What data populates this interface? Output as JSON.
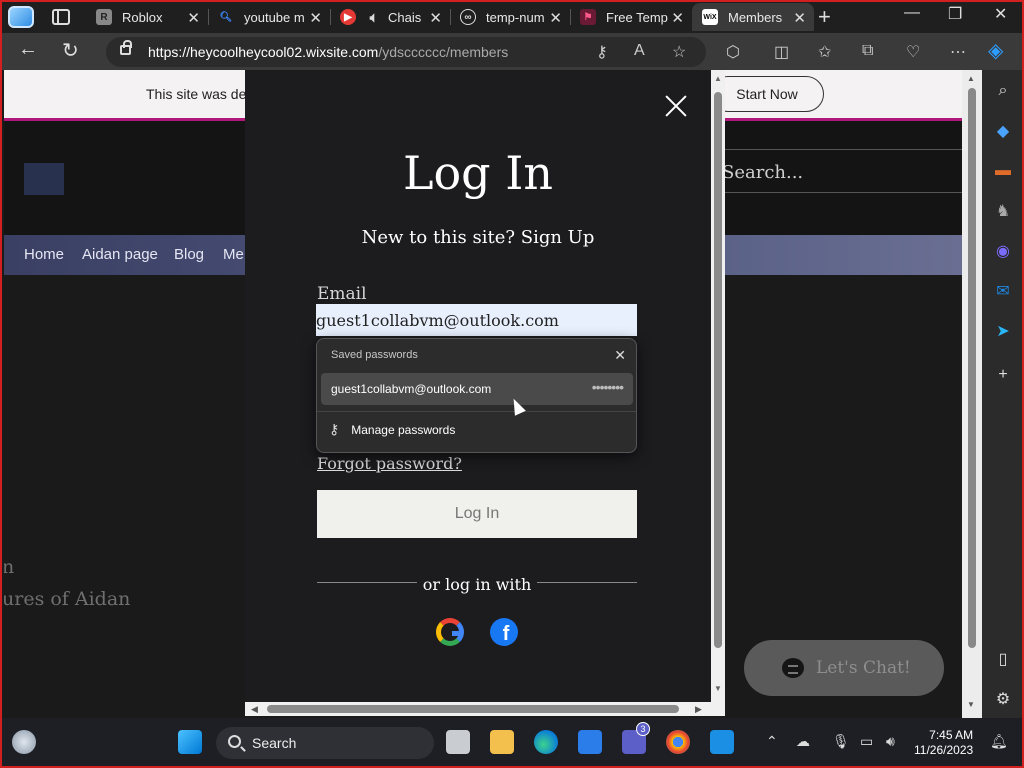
{
  "browser": {
    "tabs": [
      {
        "label": "Roblox",
        "fav": "R",
        "fav_color": "#3a3a3a"
      },
      {
        "label": "youtube m",
        "fav": "Q",
        "fav_color": "#1f6feb"
      },
      {
        "label": "Chais",
        "fav": "▶",
        "fav_color": "#e53935"
      },
      {
        "label": "temp-num",
        "fav": "⚙",
        "fav_color": "#555"
      },
      {
        "label": "Free Temp",
        "fav": "F",
        "fav_color": "#7d1d3f"
      },
      {
        "label": "Members",
        "fav": "WiX",
        "fav_color": "#ffffff"
      }
    ],
    "url_host": "https://heycoolheycool02.wixsite.com",
    "url_path": "/ydscccccc/members"
  },
  "site": {
    "banner_text": "This site was de",
    "banner_button": "Start Now",
    "search_placeholder": "Search...",
    "menu": [
      "Home",
      "Aidan page",
      "Blog",
      "Me"
    ],
    "bg_text_1": "n",
    "bg_text_2": "ures of Aidan",
    "chat_label": "Let's Chat!"
  },
  "modal": {
    "title": "Log In",
    "signup_text": "New to this site? Sign Up",
    "email_label": "Email",
    "email_value": "guest1collabvm@outlook.com",
    "forgot": "Forgot password?",
    "login_button": "Log In",
    "or_text": "or log in with"
  },
  "password_popup": {
    "title": "Saved passwords",
    "username": "guest1collabvm@outlook.com",
    "masked": "••••••••",
    "manage": "Manage passwords"
  },
  "taskbar": {
    "search": "Search",
    "time": "7:45 AM",
    "date": "11/26/2023",
    "teams_badge": "3"
  }
}
